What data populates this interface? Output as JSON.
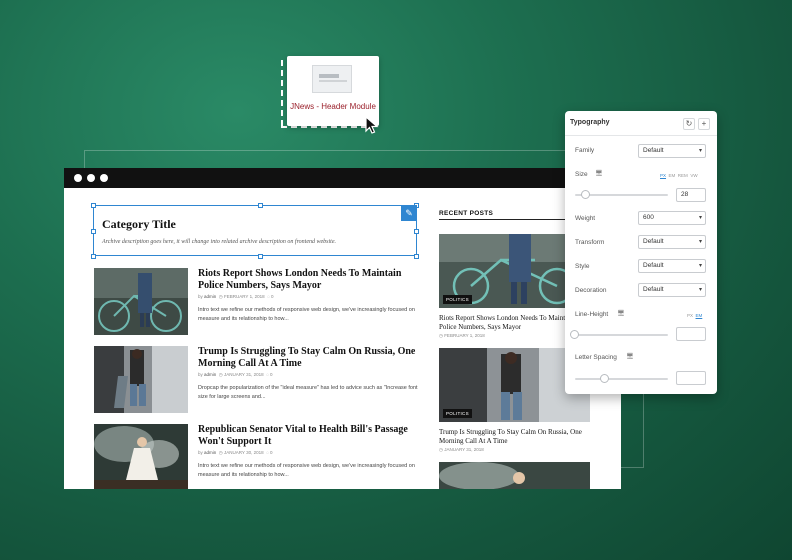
{
  "module": {
    "label": "JNews - Header Module"
  },
  "category": {
    "title": "Category Title",
    "description": "Archive description goes here, it will change into related archive description on frontend website."
  },
  "posts": [
    {
      "title": "Riots Report Shows London Needs To Maintain Police Numbers, Says Mayor",
      "by": "by",
      "author": "admin",
      "date": "FEBRUARY 1, 2018",
      "comments": "0",
      "excerpt": "Intro text we refine our methods of responsive web design, we've increasingly focused on measure and its relationship to how..."
    },
    {
      "title": "Trump Is Struggling To Stay Calm On Russia, One Morning Call At A Time",
      "by": "by",
      "author": "admin",
      "date": "JANUARY 31, 2018",
      "comments": "0",
      "excerpt": "Dropcap the popularization of the \"ideal measure\" has led to advice such as \"Increase font size for large screens and..."
    },
    {
      "title": "Republican Senator Vital to Health Bill's Passage Won't Support It",
      "by": "by",
      "author": "admin",
      "date": "JANUARY 30, 2018",
      "comments": "0",
      "excerpt": "Intro text we refine our methods of responsive web design, we've increasingly focused on measure and its relationship to how..."
    }
  ],
  "recent": {
    "heading": "RECENT POSTS",
    "items": [
      {
        "badge": "POLITICS",
        "title": "Riots Report Shows London Needs To Maintain Police Numbers, Says Mayor",
        "date": "FEBRUARY 1, 2018"
      },
      {
        "badge": "POLITICS",
        "title": "Trump Is Struggling To Stay Calm On Russia, One Morning Call At A Time",
        "date": "JANUARY 31, 2018"
      }
    ]
  },
  "panel": {
    "title": "Typography",
    "reset_icon": "↻",
    "add_icon": "+",
    "family": {
      "label": "Family",
      "value": "Default"
    },
    "size": {
      "label": "Size",
      "value": "28",
      "units": [
        "PX",
        "EM",
        "REM",
        "VW"
      ],
      "active_unit": "PX",
      "slider_fraction": 0.12
    },
    "weight": {
      "label": "Weight",
      "value": "600"
    },
    "transform": {
      "label": "Transform",
      "value": "Default"
    },
    "style": {
      "label": "Style",
      "value": "Default"
    },
    "decoration": {
      "label": "Decoration",
      "value": "Default"
    },
    "line_height": {
      "label": "Line-Height",
      "units": [
        "PX",
        "EM"
      ],
      "active_unit": "EM",
      "value": "",
      "slider_fraction": 0.0
    },
    "letter_spacing": {
      "label": "Letter Spacing",
      "value": "",
      "slider_fraction": 0.32
    }
  },
  "colors": {
    "accent": "#2f86d1",
    "module_label": "#9a1f2a"
  }
}
